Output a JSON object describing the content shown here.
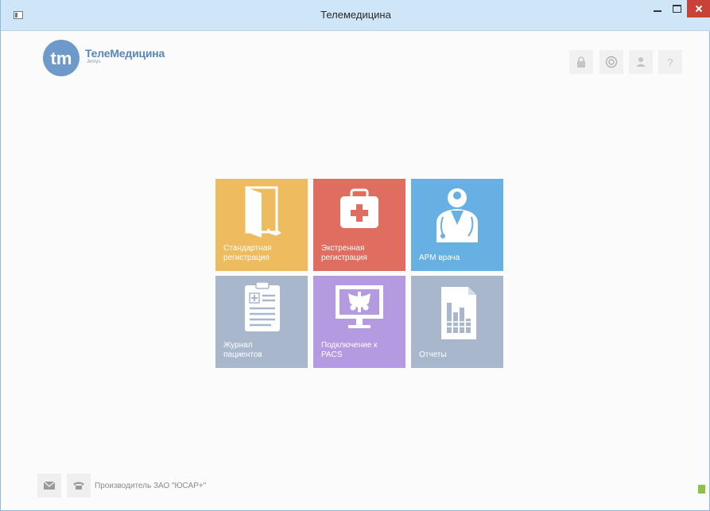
{
  "window": {
    "title": "Телемедицина"
  },
  "logo": {
    "mark": "tm",
    "name": "ТелеМедицина",
    "sub": "Jemys"
  },
  "toolbar": {
    "buttons": [
      {
        "icon": "lock-icon"
      },
      {
        "icon": "settings-icon"
      },
      {
        "icon": "user-icon"
      },
      {
        "icon": "help-icon",
        "glyph": "?"
      }
    ]
  },
  "tiles": [
    {
      "line1": "Стандартная",
      "line2": "регистрация",
      "color": "#eebb5f",
      "icon": "door-icon"
    },
    {
      "line1": "Экстренная",
      "line2": "регистрация",
      "color": "#df6e60",
      "icon": "first-aid-kit-icon"
    },
    {
      "line1": "АРМ врача",
      "line2": "",
      "color": "#66b0e4",
      "icon": "doctor-icon"
    },
    {
      "line1": "Журнал",
      "line2": "пациентов",
      "color": "#a9b7cd",
      "icon": "clipboard-icon"
    },
    {
      "line1": "Подключение к",
      "line2": "PACS",
      "color": "#b49ae0",
      "icon": "xray-monitor-icon"
    },
    {
      "line1": "Отчеты",
      "line2": "",
      "color": "#a9b7cd",
      "icon": "report-icon"
    }
  ],
  "footer": {
    "mail_icon": "mail-icon",
    "phone_icon": "phone-icon",
    "manufacturer": "Производитель ЗАО \"ЮСАР+\""
  },
  "status": {
    "indicator_color": "#8bc34a"
  }
}
